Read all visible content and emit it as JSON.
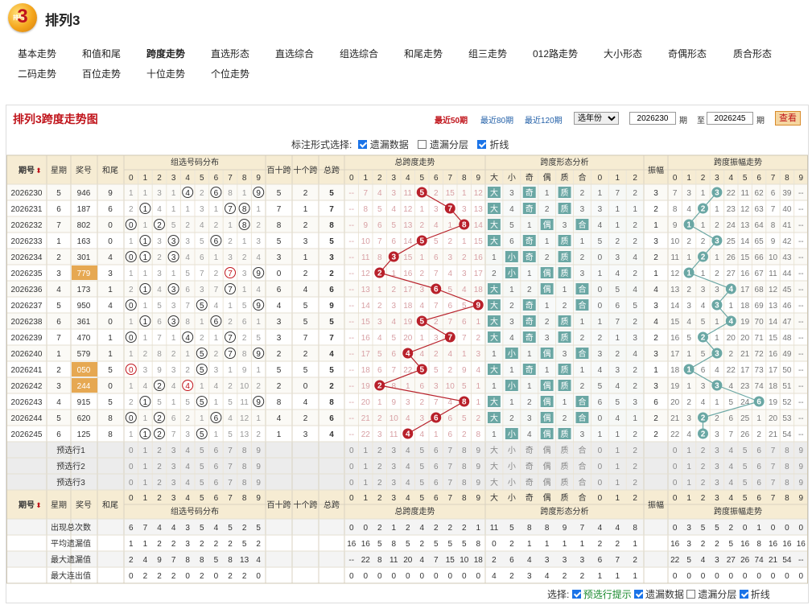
{
  "header": {
    "logo_num": "3",
    "logo_sub": "排列",
    "title": "排列3"
  },
  "nav": {
    "row1": [
      "基本走势",
      "和值和尾",
      "跨度走势",
      "直选形态",
      "直选综合",
      "组选综合",
      "和尾走势",
      "组三走势",
      "012路走势",
      "大小形态",
      "奇偶形态",
      "质合形态"
    ],
    "row2": [
      "二码走势",
      "百位走势",
      "十位走势",
      "个位走势"
    ],
    "active": "跨度走势"
  },
  "panel": {
    "title": "排列3跨度走势图",
    "recent50": "最近50期",
    "recent80": "最近80期",
    "recent120": "最近120期",
    "year_select": "选年份",
    "from": "2026230",
    "to": "2026245",
    "period": "期",
    "to_label": "至",
    "query": "查看"
  },
  "options": {
    "label": "标注形式选择:",
    "miss": "遗漏数据",
    "layer": "遗漏分层",
    "line": "折线"
  },
  "headers": {
    "issue": "期号",
    "week": "星期",
    "prize": "奖号",
    "sum_tail": "和尾",
    "group_dist": "组选号码分布",
    "bt": "百十跨",
    "tg": "十个跨",
    "total": "总跨",
    "total_trend": "总跨度走势",
    "shape": "跨度形态分析",
    "amp": "振幅",
    "amp_trend": "跨度振幅走势",
    "shape_cols": [
      "大",
      "小",
      "奇",
      "偶",
      "质",
      "合",
      "0",
      "1",
      "2"
    ],
    "digits": [
      "0",
      "1",
      "2",
      "3",
      "4",
      "5",
      "6",
      "7",
      "8",
      "9"
    ]
  },
  "rows": [
    {
      "issue": "2026230",
      "week": "5",
      "prize": "946",
      "tail": "9",
      "g": [
        "1",
        "1",
        "3",
        "1",
        "4",
        "2",
        "6",
        "8",
        "1",
        "9"
      ],
      "bt": "5",
      "tg": "2",
      "total": "5",
      "t": [
        "7",
        "4",
        "3",
        "11",
        "5",
        "2",
        "15",
        "1",
        "12",
        ""
      ],
      "sh": [
        "大",
        "3",
        "奇",
        "1",
        "质",
        "2",
        "1",
        "7",
        "2"
      ],
      "amp": "3",
      "a": [
        "7",
        "3",
        "1",
        "3",
        "22",
        "11",
        "62",
        "6",
        "39",
        ""
      ]
    },
    {
      "issue": "2026231",
      "week": "6",
      "prize": "187",
      "tail": "6",
      "g": [
        "2",
        "1",
        "4",
        "1",
        "1",
        "3",
        "1",
        "7",
        "8",
        "1"
      ],
      "bt": "7",
      "tg": "1",
      "total": "7",
      "t": [
        "8",
        "5",
        "4",
        "12",
        "1",
        "3",
        "7",
        "3",
        "13",
        ""
      ],
      "sh": [
        "大",
        "4",
        "奇",
        "2",
        "质",
        "3",
        "3",
        "1",
        "1"
      ],
      "amp": "2",
      "a": [
        "8",
        "4",
        "2",
        "1",
        "23",
        "12",
        "63",
        "7",
        "40",
        ""
      ]
    },
    {
      "issue": "2026232",
      "week": "7",
      "prize": "802",
      "tail": "0",
      "g": [
        "0",
        "1",
        "2",
        "5",
        "2",
        "4",
        "2",
        "1",
        "8",
        "2"
      ],
      "bt": "8",
      "tg": "2",
      "total": "8",
      "t": [
        "9",
        "6",
        "5",
        "13",
        "2",
        "4",
        "1",
        "8",
        "14",
        ""
      ],
      "sh": [
        "大",
        "5",
        "1",
        "偶",
        "3",
        "合",
        "4",
        "1",
        "2"
      ],
      "amp": "1",
      "a": [
        "9",
        "1",
        "1",
        "2",
        "24",
        "13",
        "64",
        "8",
        "41",
        ""
      ]
    },
    {
      "issue": "2026233",
      "week": "1",
      "prize": "163",
      "tail": "0",
      "g": [
        "1",
        "1",
        "3",
        "3",
        "3",
        "5",
        "6",
        "2",
        "1",
        "3"
      ],
      "bt": "5",
      "tg": "3",
      "total": "5",
      "t": [
        "10",
        "7",
        "6",
        "14",
        "5",
        "5",
        "2",
        "1",
        "15",
        ""
      ],
      "sh": [
        "大",
        "6",
        "奇",
        "1",
        "质",
        "1",
        "5",
        "2",
        "2"
      ],
      "amp": "3",
      "a": [
        "10",
        "2",
        "2",
        "3",
        "25",
        "14",
        "65",
        "9",
        "42",
        ""
      ]
    },
    {
      "issue": "2026234",
      "week": "2",
      "prize": "301",
      "tail": "4",
      "g": [
        "0",
        "1",
        "2",
        "3",
        "4",
        "6",
        "1",
        "3",
        "2",
        "4"
      ],
      "bt": "3",
      "tg": "1",
      "total": "3",
      "t": [
        "11",
        "8",
        "3",
        "15",
        "1",
        "6",
        "3",
        "2",
        "16",
        ""
      ],
      "sh": [
        "1",
        "小",
        "奇",
        "2",
        "质",
        "2",
        "0",
        "3",
        "4"
      ],
      "amp": "2",
      "a": [
        "11",
        "1",
        "2",
        "1",
        "26",
        "15",
        "66",
        "10",
        "43",
        ""
      ]
    },
    {
      "issue": "2026235",
      "week": "3",
      "prize": "779",
      "tail": "3",
      "g": [
        "1",
        "1",
        "3",
        "1",
        "5",
        "7",
        "2",
        "7",
        "3",
        "9"
      ],
      "bt": "0",
      "tg": "2",
      "total": "2",
      "t": [
        "12",
        "2",
        "1",
        "16",
        "2",
        "7",
        "4",
        "3",
        "17",
        ""
      ],
      "sh": [
        "2",
        "小",
        "1",
        "偶",
        "质",
        "3",
        "1",
        "4",
        "2"
      ],
      "amp": "1",
      "a": [
        "12",
        "1",
        "1",
        "2",
        "27",
        "16",
        "67",
        "11",
        "44",
        ""
      ]
    },
    {
      "issue": "2026236",
      "week": "4",
      "prize": "173",
      "tail": "1",
      "g": [
        "2",
        "1",
        "4",
        "3",
        "6",
        "3",
        "7",
        "4",
        "1",
        "4"
      ],
      "bt": "6",
      "tg": "4",
      "total": "6",
      "t": [
        "13",
        "1",
        "2",
        "17",
        "3",
        "6",
        "5",
        "4",
        "18",
        ""
      ],
      "sh": [
        "大",
        "1",
        "2",
        "偶",
        "1",
        "合",
        "0",
        "5",
        "4"
      ],
      "amp": "4",
      "a": [
        "13",
        "2",
        "3",
        "3",
        "4",
        "17",
        "68",
        "12",
        "45",
        ""
      ]
    },
    {
      "issue": "2026237",
      "week": "5",
      "prize": "950",
      "tail": "4",
      "g": [
        "0",
        "1",
        "5",
        "3",
        "7",
        "5",
        "4",
        "1",
        "5",
        "9"
      ],
      "bt": "4",
      "tg": "5",
      "total": "9",
      "t": [
        "14",
        "2",
        "3",
        "18",
        "4",
        "7",
        "6",
        "5",
        "9",
        ""
      ],
      "sh": [
        "大",
        "2",
        "奇",
        "1",
        "2",
        "合",
        "0",
        "6",
        "5"
      ],
      "amp": "3",
      "a": [
        "14",
        "3",
        "4",
        "3",
        "1",
        "18",
        "69",
        "13",
        "46",
        ""
      ]
    },
    {
      "issue": "2026238",
      "week": "6",
      "prize": "361",
      "tail": "0",
      "g": [
        "1",
        "1",
        "6",
        "3",
        "8",
        "1",
        "6",
        "2",
        "6",
        "1"
      ],
      "bt": "3",
      "tg": "5",
      "total": "5",
      "t": [
        "15",
        "3",
        "4",
        "19",
        "5",
        "2",
        "7",
        "6",
        "1",
        ""
      ],
      "sh": [
        "大",
        "3",
        "奇",
        "2",
        "质",
        "1",
        "1",
        "7",
        "2"
      ],
      "amp": "4",
      "a": [
        "15",
        "4",
        "5",
        "1",
        "4",
        "19",
        "70",
        "14",
        "47",
        ""
      ]
    },
    {
      "issue": "2026239",
      "week": "7",
      "prize": "470",
      "tail": "1",
      "g": [
        "0",
        "1",
        "7",
        "1",
        "4",
        "2",
        "1",
        "7",
        "2",
        "5"
      ],
      "bt": "3",
      "tg": "7",
      "total": "7",
      "t": [
        "16",
        "4",
        "5",
        "20",
        "1",
        "3",
        "7",
        "7",
        "2",
        ""
      ],
      "sh": [
        "大",
        "4",
        "奇",
        "3",
        "质",
        "2",
        "2",
        "1",
        "3"
      ],
      "amp": "2",
      "a": [
        "16",
        "5",
        "2",
        "1",
        "20",
        "20",
        "71",
        "15",
        "48",
        ""
      ]
    },
    {
      "issue": "2026240",
      "week": "1",
      "prize": "579",
      "tail": "1",
      "g": [
        "1",
        "2",
        "8",
        "2",
        "1",
        "5",
        "2",
        "7",
        "8",
        "9"
      ],
      "bt": "2",
      "tg": "2",
      "total": "4",
      "t": [
        "17",
        "5",
        "6",
        "21",
        "4",
        "2",
        "4",
        "1",
        "3",
        ""
      ],
      "sh": [
        "1",
        "小",
        "1",
        "偶",
        "3",
        "合",
        "3",
        "2",
        "4"
      ],
      "amp": "3",
      "a": [
        "17",
        "1",
        "5",
        "3",
        "2",
        "21",
        "72",
        "16",
        "49",
        ""
      ]
    },
    {
      "issue": "2026241",
      "week": "2",
      "prize": "050",
      "tail": "5",
      "g": [
        "0",
        "3",
        "9",
        "3",
        "2",
        "5",
        "3",
        "1",
        "9",
        "1"
      ],
      "bt": "5",
      "tg": "5",
      "total": "5",
      "t": [
        "18",
        "6",
        "7",
        "22",
        "5",
        "5",
        "2",
        "9",
        "4",
        ""
      ],
      "sh": [
        "大",
        "1",
        "奇",
        "1",
        "质",
        "1",
        "4",
        "3",
        "2"
      ],
      "amp": "1",
      "a": [
        "18",
        "1",
        "6",
        "4",
        "22",
        "17",
        "73",
        "17",
        "50",
        ""
      ]
    },
    {
      "issue": "2026242",
      "week": "3",
      "prize": "244",
      "tail": "0",
      "g": [
        "1",
        "4",
        "2",
        "4",
        "4",
        "1",
        "4",
        "2",
        "10",
        "2"
      ],
      "bt": "2",
      "tg": "0",
      "total": "2",
      "t": [
        "19",
        "2",
        "8",
        "1",
        "6",
        "3",
        "10",
        "5",
        "1",
        ""
      ],
      "sh": [
        "1",
        "小",
        "1",
        "偶",
        "质",
        "2",
        "5",
        "4",
        "2"
      ],
      "amp": "3",
      "a": [
        "19",
        "1",
        "3",
        "3",
        "4",
        "23",
        "74",
        "18",
        "51",
        ""
      ]
    },
    {
      "issue": "2026243",
      "week": "4",
      "prize": "915",
      "tail": "5",
      "g": [
        "2",
        "1",
        "5",
        "1",
        "5",
        "5",
        "1",
        "5",
        "11",
        "9"
      ],
      "bt": "8",
      "tg": "4",
      "total": "8",
      "t": [
        "20",
        "1",
        "9",
        "3",
        "2",
        "7",
        "4",
        "8",
        "1",
        ""
      ],
      "sh": [
        "大",
        "1",
        "2",
        "偶",
        "1",
        "合",
        "6",
        "5",
        "3"
      ],
      "amp": "6",
      "a": [
        "20",
        "2",
        "4",
        "1",
        "5",
        "24",
        "6",
        "19",
        "52",
        ""
      ]
    },
    {
      "issue": "2026244",
      "week": "5",
      "prize": "620",
      "tail": "8",
      "g": [
        "0",
        "1",
        "2",
        "6",
        "2",
        "1",
        "6",
        "4",
        "12",
        "1"
      ],
      "bt": "4",
      "tg": "2",
      "total": "6",
      "t": [
        "21",
        "2",
        "10",
        "4",
        "3",
        "8",
        "6",
        "5",
        "2",
        ""
      ],
      "sh": [
        "大",
        "2",
        "3",
        "偶",
        "2",
        "合",
        "0",
        "4",
        "1"
      ],
      "amp": "2",
      "a": [
        "21",
        "3",
        "2",
        "2",
        "6",
        "25",
        "1",
        "20",
        "53",
        ""
      ]
    },
    {
      "issue": "2026245",
      "week": "6",
      "prize": "125",
      "tail": "8",
      "g": [
        "1",
        "1",
        "2",
        "7",
        "3",
        "5",
        "1",
        "5",
        "13",
        "2"
      ],
      "bt": "1",
      "tg": "3",
      "total": "4",
      "t": [
        "22",
        "3",
        "11",
        "4",
        "4",
        "1",
        "6",
        "2",
        "8",
        ""
      ],
      "sh": [
        "1",
        "小",
        "4",
        "偶",
        "质",
        "3",
        "1",
        "1",
        "2"
      ],
      "amp": "2",
      "a": [
        "22",
        "4",
        "2",
        "3",
        "7",
        "26",
        "2",
        "21",
        "54",
        ""
      ]
    }
  ],
  "hits": [
    {
      "g": [
        4,
        6,
        9
      ],
      "t": 5,
      "a": 3
    },
    {
      "g": [
        1,
        7,
        8
      ],
      "t": 7,
      "a": 2
    },
    {
      "g": [
        0,
        2,
        8
      ],
      "t": 8,
      "a": 1
    },
    {
      "g": [
        1,
        3,
        6
      ],
      "t": 5,
      "a": 3
    },
    {
      "g": [
        0,
        1,
        3
      ],
      "t": 3,
      "a": 2
    },
    {
      "g": [
        7,
        9
      ],
      "t": 2,
      "a": 1
    },
    {
      "g": [
        1,
        3,
        7
      ],
      "t": 6,
      "a": 4
    },
    {
      "g": [
        0,
        5,
        9
      ],
      "t": 9,
      "a": 3
    },
    {
      "g": [
        1,
        3,
        6
      ],
      "t": 5,
      "a": 4
    },
    {
      "g": [
        0,
        4,
        7
      ],
      "t": 7,
      "a": 2
    },
    {
      "g": [
        5,
        7,
        9
      ],
      "t": 4,
      "a": 3
    },
    {
      "g": [
        0,
        5
      ],
      "t": 5,
      "a": 1
    },
    {
      "g": [
        2,
        4
      ],
      "t": 2,
      "a": 3
    },
    {
      "g": [
        1,
        5,
        9
      ],
      "t": 8,
      "a": 6
    },
    {
      "g": [
        0,
        2,
        6
      ],
      "t": 6,
      "a": 2
    },
    {
      "g": [
        1,
        2,
        5
      ],
      "t": 4,
      "a": 2
    }
  ],
  "sh_hits": [
    [
      0,
      2,
      4
    ],
    [
      0,
      2,
      4
    ],
    [
      0,
      3,
      5
    ],
    [
      0,
      2,
      4
    ],
    [
      1,
      2,
      4
    ],
    [
      1,
      3,
      4
    ],
    [
      0,
      3,
      5
    ],
    [
      0,
      2,
      5
    ],
    [
      0,
      2,
      4
    ],
    [
      0,
      2,
      4
    ],
    [
      1,
      3,
      5
    ],
    [
      0,
      2,
      4
    ],
    [
      1,
      3,
      4
    ],
    [
      0,
      3,
      5
    ],
    [
      0,
      3,
      5
    ],
    [
      1,
      3,
      4
    ]
  ],
  "pick_rows": [
    "预选行1",
    "预选行2",
    "预选行3"
  ],
  "stats": {
    "labels": [
      "出现总次数",
      "平均遗漏值",
      "最大遗漏值",
      "最大连出值"
    ],
    "g": [
      [
        "6",
        "7",
        "4",
        "4",
        "3",
        "5",
        "4",
        "5",
        "2",
        "5"
      ],
      [
        "1",
        "1",
        "2",
        "2",
        "3",
        "2",
        "2",
        "2",
        "5",
        "2"
      ],
      [
        "2",
        "4",
        "9",
        "7",
        "8",
        "8",
        "5",
        "8",
        "13",
        "4"
      ],
      [
        "0",
        "2",
        "2",
        "2",
        "0",
        "2",
        "0",
        "2",
        "2",
        "0"
      ]
    ],
    "t": [
      [
        "0",
        "0",
        "2",
        "1",
        "2",
        "4",
        "2",
        "2",
        "2",
        "1"
      ],
      [
        "16",
        "16",
        "5",
        "8",
        "5",
        "2",
        "5",
        "5",
        "5",
        "8"
      ],
      [
        "--",
        "22",
        "8",
        "11",
        "20",
        "4",
        "7",
        "15",
        "10",
        "18"
      ],
      [
        "0",
        "0",
        "0",
        "0",
        "0",
        "0",
        "0",
        "0",
        "0",
        "0"
      ]
    ],
    "s": [
      [
        "11",
        "5",
        "8",
        "8",
        "9",
        "7",
        "4",
        "4",
        "8"
      ],
      [
        "0",
        "2",
        "1",
        "1",
        "1",
        "1",
        "2",
        "2",
        "1"
      ],
      [
        "2",
        "6",
        "4",
        "3",
        "3",
        "3",
        "6",
        "7",
        "2"
      ],
      [
        "4",
        "2",
        "3",
        "4",
        "2",
        "2",
        "1",
        "1",
        "1"
      ]
    ],
    "a": [
      [
        "0",
        "3",
        "5",
        "5",
        "2",
        "0",
        "1",
        "0",
        "0",
        "0"
      ],
      [
        "16",
        "3",
        "2",
        "2",
        "5",
        "16",
        "8",
        "16",
        "16",
        "16"
      ],
      [
        "22",
        "5",
        "4",
        "3",
        "27",
        "26",
        "74",
        "21",
        "54",
        "--"
      ],
      [
        "0",
        "0",
        "0",
        "0",
        "0",
        "0",
        "0",
        "0",
        "0",
        "0"
      ]
    ]
  },
  "bottom": {
    "label": "选择:",
    "pick": "预选行提示",
    "miss": "遗漏数据",
    "layer": "遗漏分层",
    "line": "折线"
  },
  "colors": {
    "red_ball": "#b8202a",
    "teal_ball": "#6aa7a4",
    "hit_dark": "#1a3d3b",
    "blue_box": "#6aa7a4",
    "orange_box": "#d89a4a",
    "header_bg": "#f6ecd3",
    "row_bg": "#f8f4ea"
  }
}
